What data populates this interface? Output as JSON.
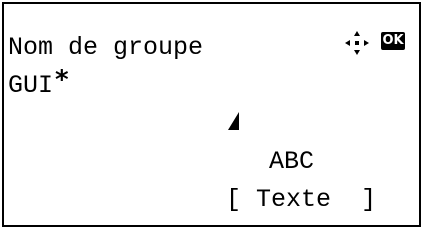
{
  "screen": {
    "title": "Nom de groupe",
    "value": "GUI",
    "required_marker": "*",
    "ok_label": "OK",
    "input_mode": "ABC",
    "softkey": {
      "open": "[",
      "label": "Texte",
      "close": "]"
    }
  },
  "icons": {
    "nav": "four-way-navigation-icon",
    "ok": "ok-key-icon",
    "cursor": "text-cursor-icon"
  },
  "colors": {
    "foreground": "#000000",
    "background": "#ffffff"
  }
}
